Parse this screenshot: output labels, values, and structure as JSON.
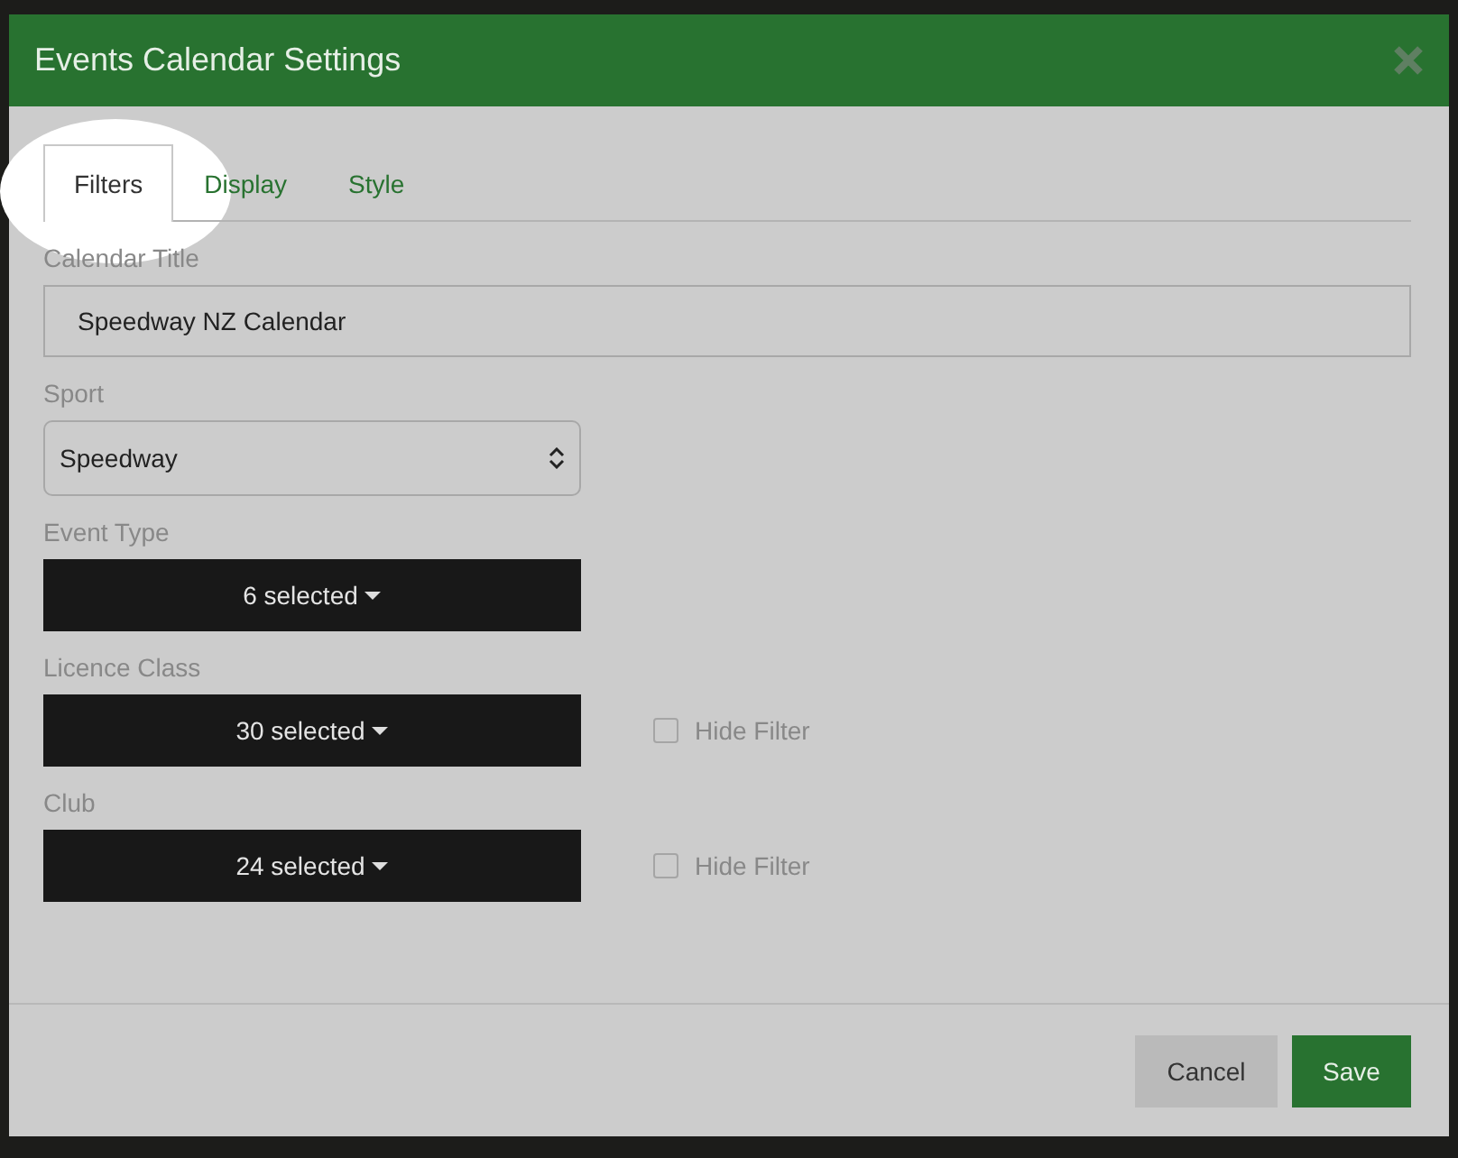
{
  "dialog": {
    "title": "Events Calendar Settings"
  },
  "tabs": [
    {
      "label": "Filters",
      "selected": true
    },
    {
      "label": "Display",
      "selected": false
    },
    {
      "label": "Style",
      "selected": false
    }
  ],
  "fields": [
    {
      "kind": "text",
      "label": "Calendar Title",
      "value": "Speedway NZ Calendar"
    },
    {
      "kind": "select",
      "label": "Sport",
      "value": "Speedway"
    },
    {
      "kind": "multi",
      "label": "Event Type",
      "value": "6 selected"
    },
    {
      "kind": "multi",
      "label": "Licence Class",
      "value": "30 selected",
      "hide_filter": {
        "label": "Hide Filter",
        "checked": false
      }
    },
    {
      "kind": "multi",
      "label": "Club",
      "value": "24 selected",
      "hide_filter": {
        "label": "Hide Filter",
        "checked": false
      }
    }
  ],
  "buttons": [
    {
      "label": "Cancel",
      "kind": "secondary"
    },
    {
      "label": "Save",
      "kind": "primary"
    }
  ]
}
